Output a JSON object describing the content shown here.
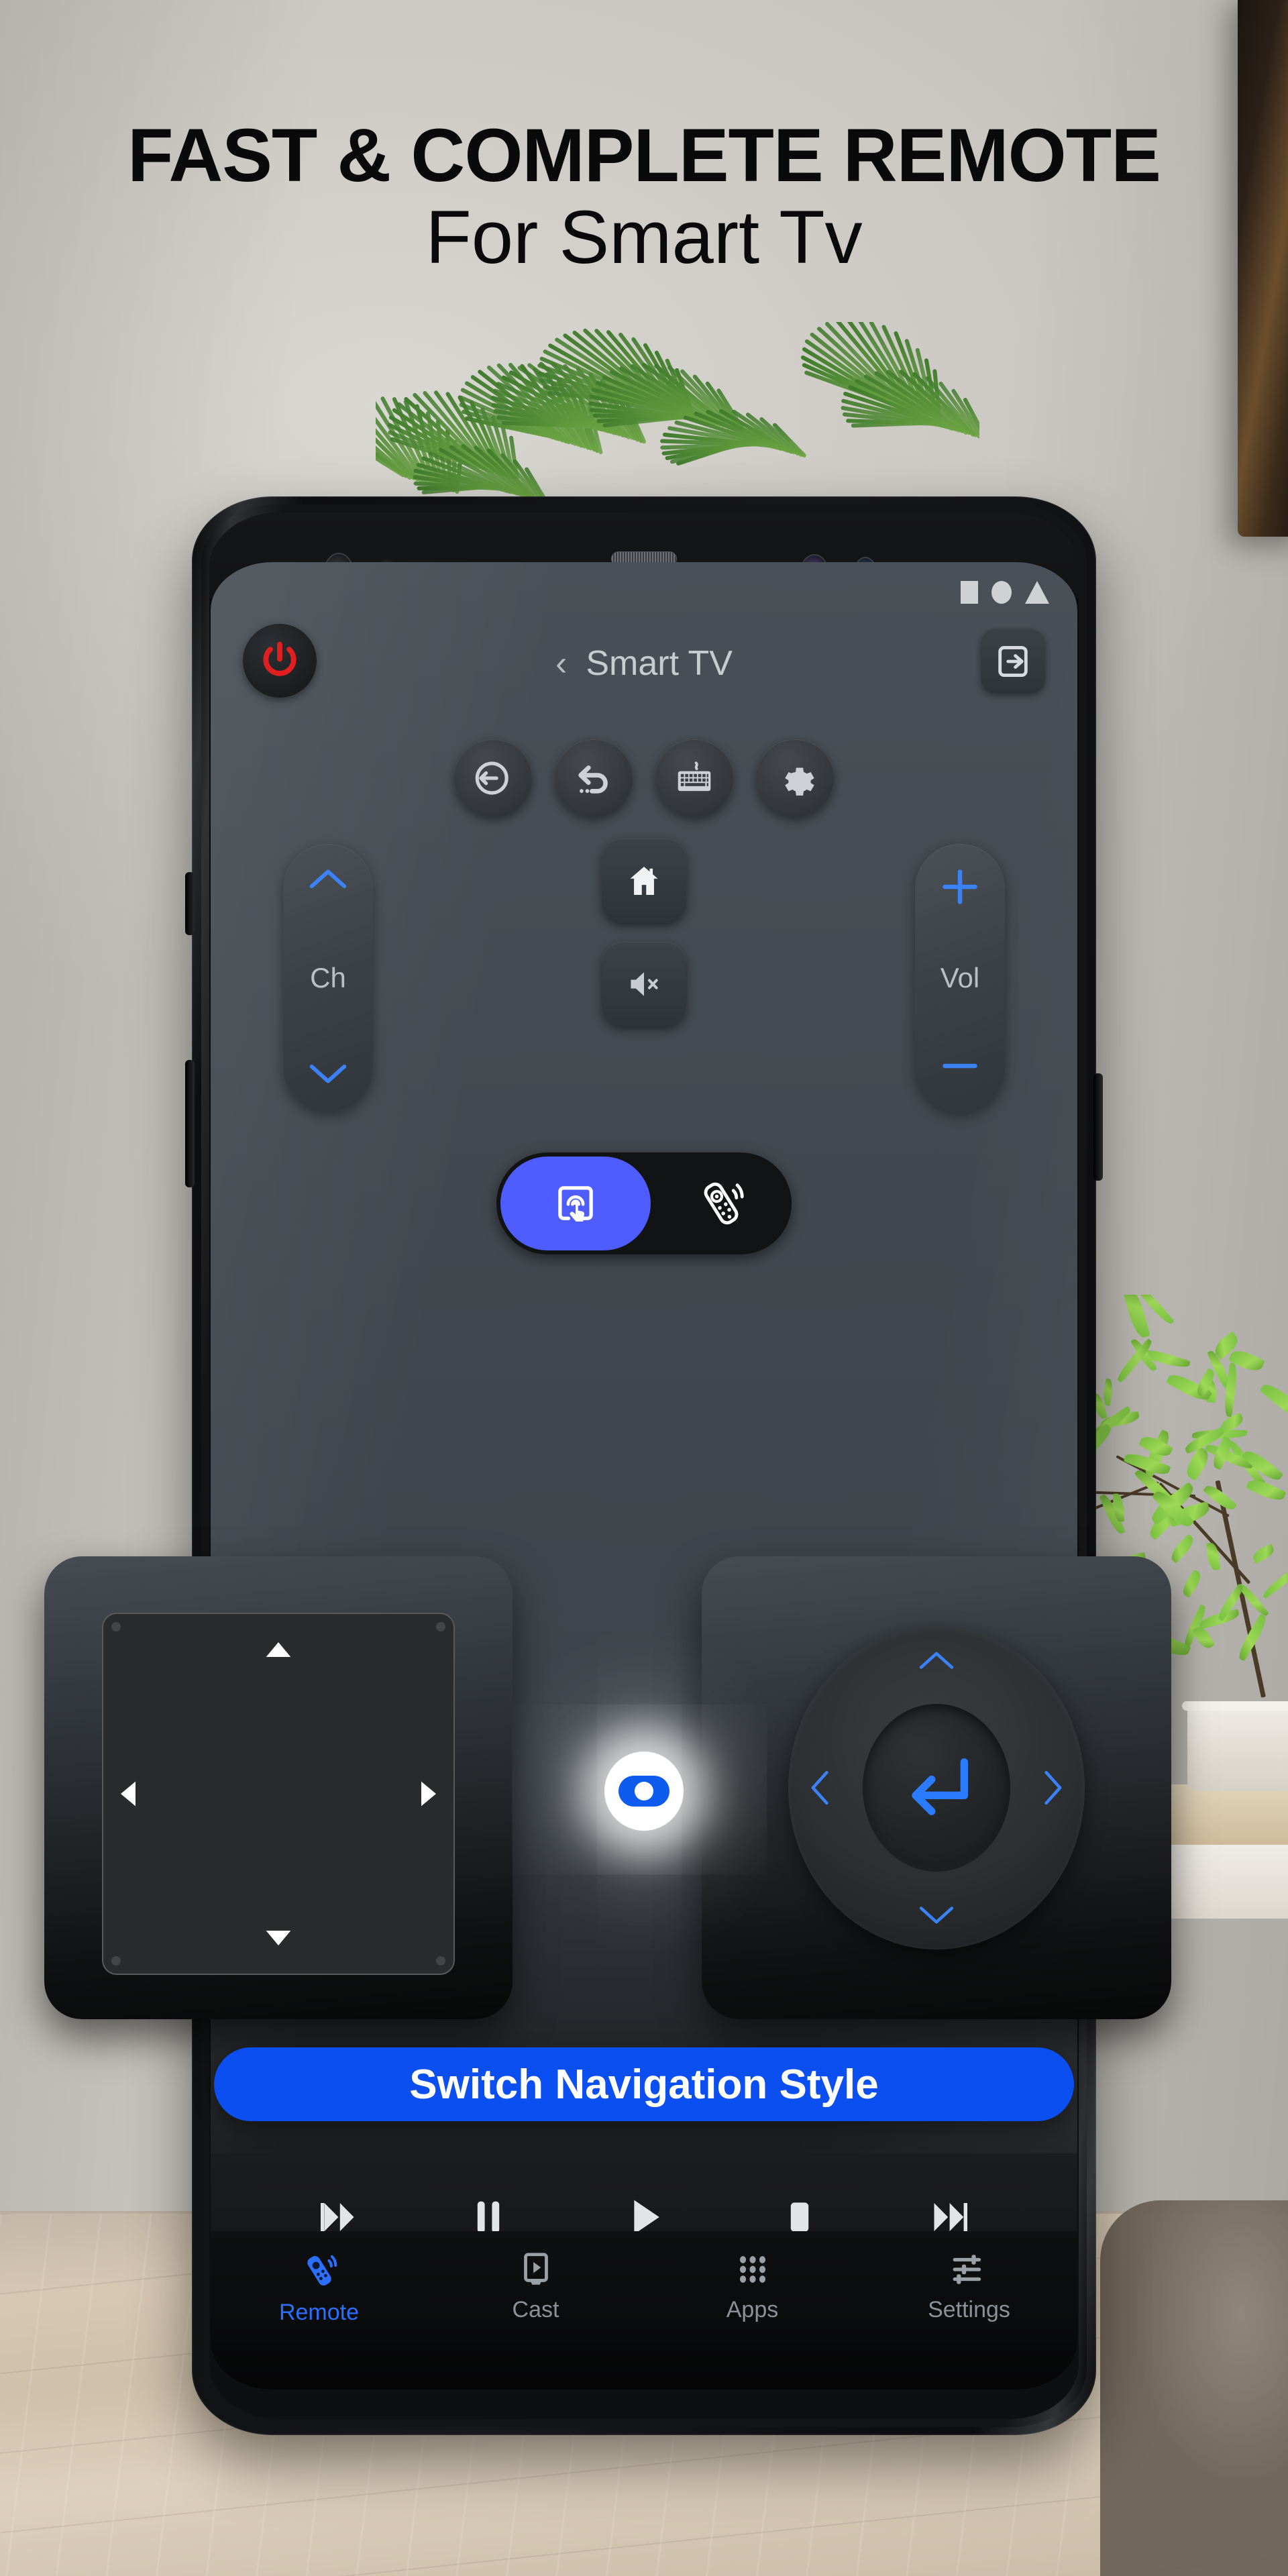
{
  "promo": {
    "headline_line1": "FAST & COMPLETE REMOTE",
    "headline_line2": "For Smart Tv",
    "cta_label": "Switch Navigation Style"
  },
  "statusbar": {
    "icons": [
      "square-icon",
      "circle-icon",
      "triangle-icon"
    ]
  },
  "topbar": {
    "power_icon": "power-icon",
    "back_chevron": "‹",
    "title": "Smart TV",
    "exit_icon": "exit-app-icon"
  },
  "function_row": [
    {
      "name": "source-input-icon",
      "label": "Source"
    },
    {
      "name": "back-icon",
      "label": "Back"
    },
    {
      "name": "keyboard-icon",
      "label": "Keyboard"
    },
    {
      "name": "settings-gear-icon",
      "label": "Settings"
    }
  ],
  "controls": {
    "channel": {
      "label": "Ch",
      "up_icon": "chevron-up-icon",
      "down_icon": "chevron-down-icon"
    },
    "volume": {
      "label": "Vol",
      "up_icon": "plus-icon",
      "down_icon": "minus-icon"
    },
    "home": {
      "icon": "home-icon"
    },
    "mute": {
      "icon": "mute-icon"
    }
  },
  "mode_toggle": {
    "selected": "touchpad",
    "options": [
      {
        "id": "touchpad",
        "icon": "touchpad-tap-icon"
      },
      {
        "id": "remote",
        "icon": "remote-control-icon"
      }
    ]
  },
  "nav_compare": {
    "left_panel": {
      "style": "touchpad",
      "arrows": [
        "up-arrow-icon",
        "right-arrow-icon",
        "down-arrow-icon",
        "left-arrow-icon"
      ]
    },
    "right_panel": {
      "style": "dpad",
      "center_icon": "enter-return-icon",
      "chevrons": [
        "chevron-up-icon",
        "chevron-right-icon",
        "chevron-down-icon",
        "chevron-left-icon"
      ]
    },
    "badge_icon": "toggle-switch-icon"
  },
  "media": [
    {
      "name": "previous-track-icon"
    },
    {
      "name": "pause-icon"
    },
    {
      "name": "play-icon"
    },
    {
      "name": "stop-icon"
    },
    {
      "name": "next-track-icon"
    }
  ],
  "bottom_nav": {
    "active": "Remote",
    "items": [
      {
        "label": "Remote",
        "icon": "remote-control-icon"
      },
      {
        "label": "Cast",
        "icon": "cast-screen-icon"
      },
      {
        "label": "Apps",
        "icon": "apps-grid-icon"
      },
      {
        "label": "Settings",
        "icon": "sliders-icon"
      }
    ]
  },
  "colors": {
    "accent_blue": "#0b4ff0",
    "toggle_blue": "#4f5dff",
    "power_red": "#e02020",
    "chevron_blue": "#3b82f6",
    "screen_bg": "#434950"
  }
}
